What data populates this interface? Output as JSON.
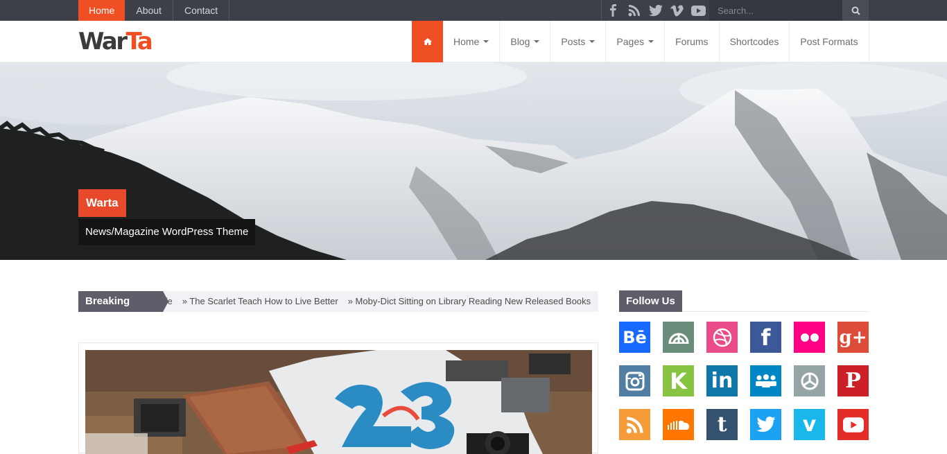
{
  "topbar": {
    "nav": [
      "Home",
      "About",
      "Contact"
    ],
    "social_icons": [
      "facebook-icon",
      "rss-icon",
      "twitter-icon",
      "vimeo-icon",
      "youtube-icon"
    ],
    "search_placeholder": "Search..."
  },
  "header": {
    "logo_part1": "War",
    "logo_part2": "Ta",
    "nav": [
      "Home",
      "Blog",
      "Posts",
      "Pages",
      "Forums",
      "Shortcodes",
      "Post Formats"
    ]
  },
  "hero": {
    "title": "Warta",
    "subtitle": "News/Magazine WordPress Theme"
  },
  "breaking": {
    "label": "Breaking News",
    "items": [
      "ife",
      "» The Scarlet Teach How to Live Better",
      "» Moby-Dict Sitting on Library Reading New Released Books"
    ]
  },
  "follow": {
    "title": "Follow Us",
    "tiles": [
      {
        "name": "behance",
        "text": "Bē",
        "color": "#1769ff"
      },
      {
        "name": "delicious",
        "text": "",
        "color": "#6a8d7b"
      },
      {
        "name": "dribbble",
        "text": "",
        "color": "#ea4c89"
      },
      {
        "name": "facebook",
        "text": "f",
        "color": "#3b5998"
      },
      {
        "name": "flickr",
        "text": "",
        "color": "#ff0084"
      },
      {
        "name": "google-plus",
        "text": "g+",
        "color": "#dd4b39"
      },
      {
        "name": "instagram",
        "text": "",
        "color": "#517fa4"
      },
      {
        "name": "kickstarter",
        "text": "K",
        "color": "#87c442"
      },
      {
        "name": "linkedin",
        "text": "in",
        "color": "#0e76a8"
      },
      {
        "name": "myspace",
        "text": "",
        "color": "#0086c5"
      },
      {
        "name": "picasa",
        "text": "",
        "color": "#95a5a6"
      },
      {
        "name": "pinterest",
        "text": "P",
        "color": "#cb2027"
      },
      {
        "name": "rss",
        "text": "",
        "color": "#f59b3a"
      },
      {
        "name": "soundcloud",
        "text": "",
        "color": "#ff7700"
      },
      {
        "name": "tumblr",
        "text": "t",
        "color": "#34526f"
      },
      {
        "name": "twitter",
        "text": "",
        "color": "#1da1f2"
      },
      {
        "name": "vimeo",
        "text": "v",
        "color": "#1ab7ea"
      },
      {
        "name": "youtube",
        "text": "",
        "color": "#e52d27"
      }
    ]
  },
  "colors": {
    "accent": "#f04e23",
    "topbar": "#3e4049",
    "dark_label": "#5d5e69"
  }
}
